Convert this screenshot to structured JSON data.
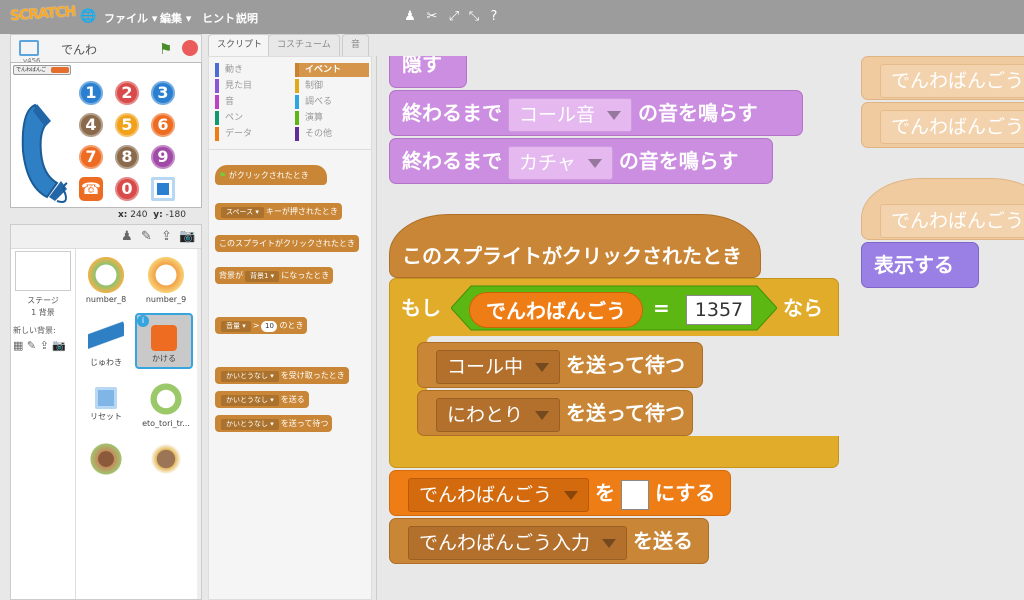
{
  "menubar": {
    "logo": "SCRATCH",
    "file": "ファイル ▾",
    "edit": "編集 ▾",
    "tips": "ヒント",
    "about": "説明"
  },
  "stage_header": {
    "sprite_name": "でんわ",
    "version": "v456"
  },
  "stage": {
    "var_label": "でんわばんご",
    "keys": [
      "1",
      "2",
      "3",
      "4",
      "5",
      "6",
      "7",
      "8",
      "9",
      "",
      "0",
      ""
    ]
  },
  "coords": {
    "x_label": "x:",
    "x": "240",
    "y_label": "y:",
    "y": "-180"
  },
  "sprites_panel": {
    "stage_label": "ステージ",
    "stage_sub": "1 背景",
    "new_backdrop": "新しい背景:",
    "sprites": [
      {
        "name": "number_8"
      },
      {
        "name": "number_9"
      },
      {
        "name": "じゅわき"
      },
      {
        "name": "かける"
      },
      {
        "name": "リセット"
      },
      {
        "name": "eto_tori_tr..."
      },
      {
        "name": ""
      },
      {
        "name": ""
      }
    ]
  },
  "tabs": [
    "スクリプト",
    "コスチューム",
    "音"
  ],
  "categories": {
    "left": [
      "動き",
      "見た目",
      "音",
      "ペン",
      "データ"
    ],
    "right": [
      "イベント",
      "制御",
      "調べる",
      "演算",
      "その他"
    ]
  },
  "palette": {
    "flag_hat": "がクリックされたとき",
    "key_dd": "スペース ▾",
    "key_hat": "キーが押されたとき",
    "sprite_hat": "このスプライトがクリックされたとき",
    "backdrop_pre": "背景が",
    "backdrop_dd": "背景1 ▾",
    "backdrop_post": "になったとき",
    "loud_dd": "音量 ▾",
    "loud_gt": ">",
    "loud_num": "10",
    "loud_post": "のとき",
    "recv_dd": "かいとうなし ▾",
    "recv_post": "を受け取ったとき",
    "bc_dd": "かいとうなし ▾",
    "bc_post": "を送る",
    "bcw_dd": "かいとうなし ▾",
    "bcw_post": "を送って待つ"
  },
  "scripts": {
    "hide_partial": "隠す",
    "play1_pre": "終わるまで",
    "play1_sound": "コール音",
    "play1_post": "の音を鳴らす",
    "play2_pre": "終わるまで",
    "play2_sound": "カチャ",
    "play2_post": "の音を鳴らす",
    "hat": "このスプライトがクリックされたとき",
    "if_label": "もし",
    "if_var": "でんわばんごう",
    "if_eq": "=",
    "if_value": "1357",
    "if_then": "なら",
    "bc1_msg": "コール中",
    "bc1_post": "を送って待つ",
    "bc2_msg": "にわとり",
    "bc2_post": "を送って待つ",
    "set_var": "でんわばんごう",
    "set_to": "を",
    "set_post": "にする",
    "bc3_msg": "でんわばんごう入力",
    "bc3_post": "を送る",
    "right_top1": "でんわばんごう",
    "right_top2": "でんわばんごう入",
    "right_mid": "でんわばんごう入",
    "show": "表示する"
  },
  "colors": {
    "events": "#c98636",
    "control": "#e1ac2a",
    "data": "#ee7d16",
    "looks": "#9a7fe4",
    "sound": "#cc8ee0"
  }
}
